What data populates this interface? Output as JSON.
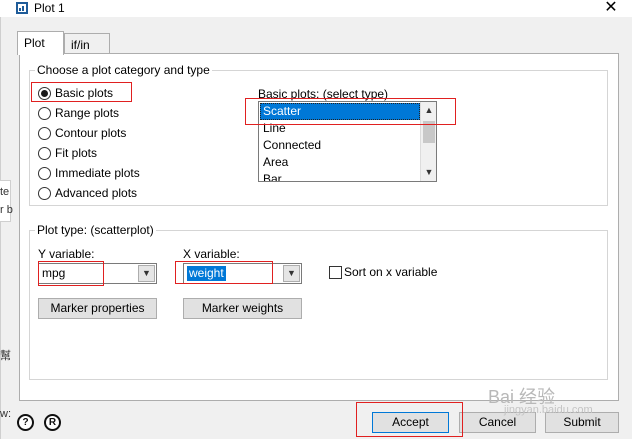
{
  "window": {
    "title": "Plot 1",
    "close_glyph": "✕"
  },
  "background_fragments": [
    "te",
    "r b",
    "幫",
    "w:"
  ],
  "tabs": [
    {
      "label": "Plot",
      "active": true
    },
    {
      "label": "if/in",
      "active": false
    }
  ],
  "category_group": {
    "label": "Choose a plot category and type",
    "options": [
      {
        "label": "Basic plots",
        "selected": true
      },
      {
        "label": "Range plots",
        "selected": false
      },
      {
        "label": "Contour plots",
        "selected": false
      },
      {
        "label": "Fit plots",
        "selected": false
      },
      {
        "label": "Immediate plots",
        "selected": false
      },
      {
        "label": "Advanced plots",
        "selected": false
      }
    ],
    "basic_plots_label": "Basic plots: (select type)",
    "basic_plots_items": [
      "Scatter",
      "Line",
      "Connected",
      "Area",
      "Bar"
    ],
    "basic_plots_selected": "Scatter"
  },
  "plot_type_group": {
    "label": "Plot type: (scatterplot)",
    "y_label": "Y variable:",
    "y_value": "mpg",
    "x_label": "X variable:",
    "x_value": "weight",
    "sort_label": "Sort on x variable",
    "sort_checked": false,
    "marker_properties_label": "Marker properties",
    "marker_weights_label": "Marker weights"
  },
  "footer": {
    "help_icon_glyph": "?",
    "reset_icon_glyph": "R",
    "accept_label": "Accept",
    "cancel_label": "Cancel",
    "submit_label": "Submit"
  },
  "watermark": {
    "text": "Bai 经验",
    "url": "jingyan.baidu.com"
  },
  "colors": {
    "selection": "#0078d7",
    "highlight_box": "#e02020",
    "dialog_bg": "#f0f0f0"
  }
}
